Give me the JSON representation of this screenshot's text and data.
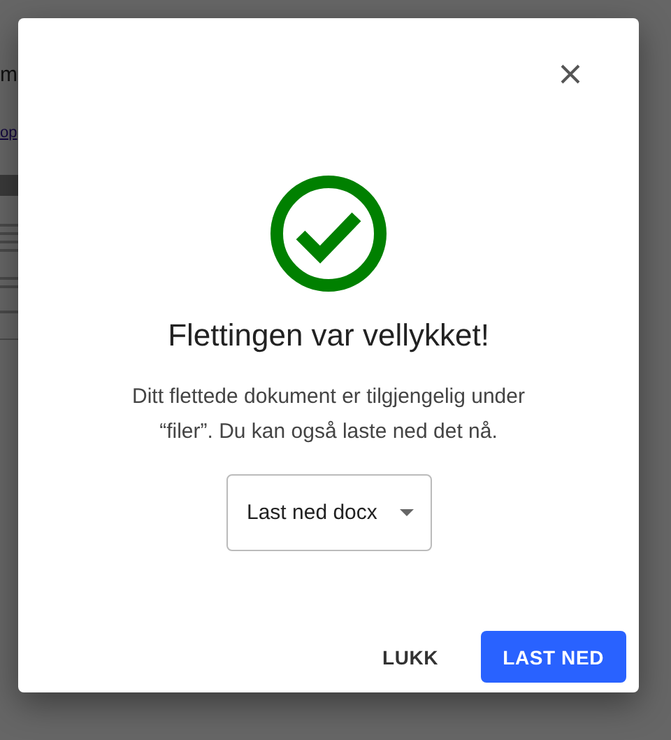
{
  "background_page": {
    "heading": "m",
    "link": "op"
  },
  "dialog": {
    "title": "Flettingen var vellykket!",
    "message": "Ditt flettede dokument er tilgjengelig under “filer”. Du kan også laste ned det nå.",
    "format_select": {
      "value": "Last ned docx"
    },
    "buttons": [
      {
        "label": "LUKK",
        "kind": "text"
      },
      {
        "label": "LAST NED",
        "kind": "primary"
      }
    ]
  }
}
